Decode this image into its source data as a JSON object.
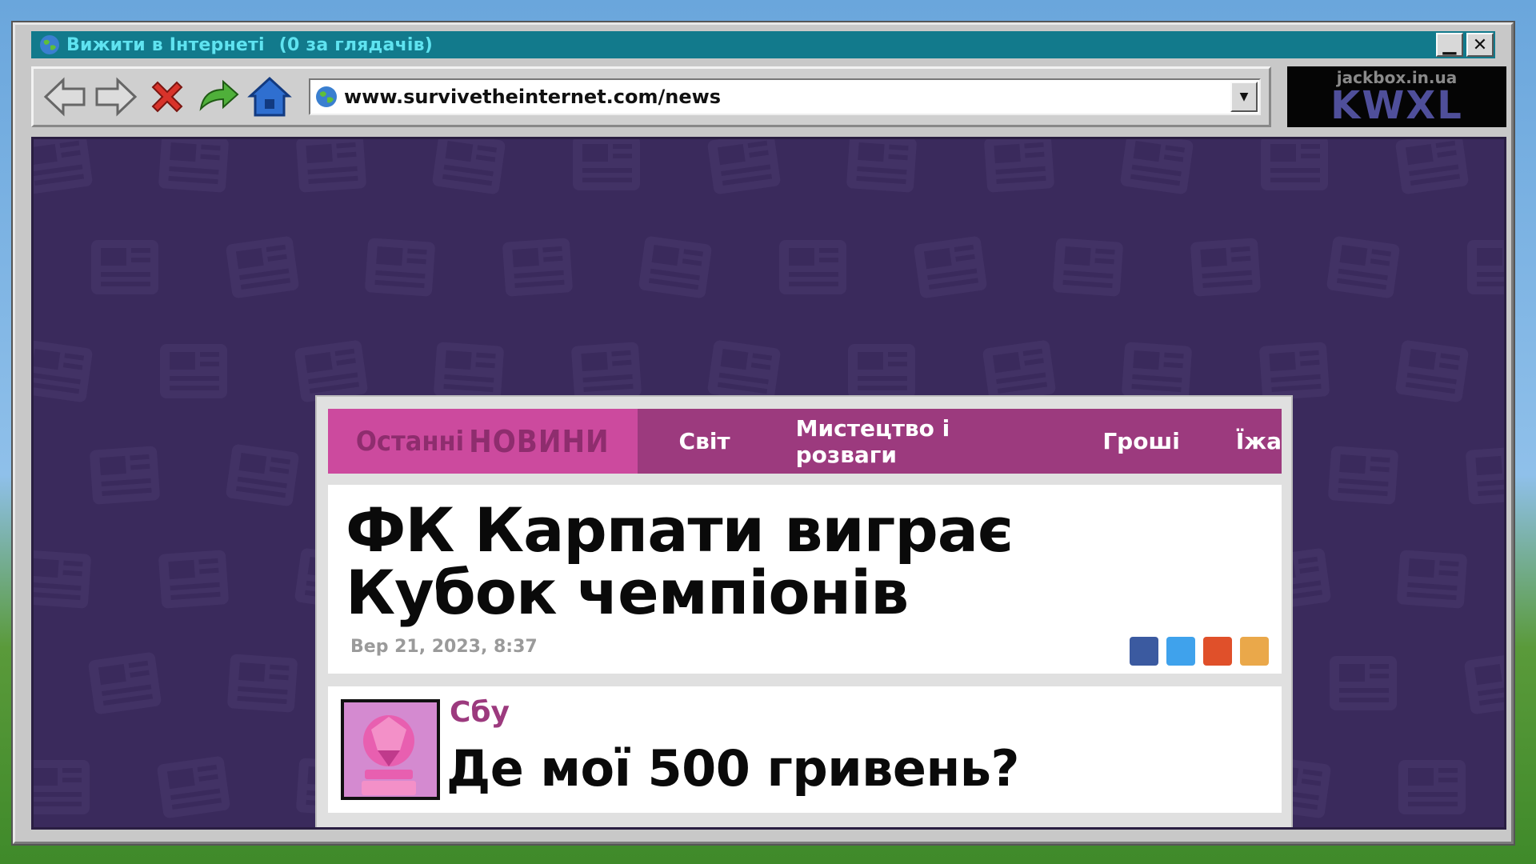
{
  "window": {
    "title": "Вижити в Інтернеті",
    "viewers": "(0 за глядачів)",
    "minimize_label": "▁",
    "close_label": "✕"
  },
  "toolbar": {
    "icons": [
      "back-arrow-icon",
      "forward-arrow-icon",
      "stop-icon",
      "refresh-icon",
      "home-icon"
    ],
    "url": "www.survivetheinternet.com/news",
    "dropdown_label": "▼"
  },
  "room": {
    "domain": "jackbox.in.ua",
    "code": "KWXL"
  },
  "news": {
    "brand_part1": "Останні",
    "brand_part2": "НОВИНИ",
    "nav": [
      "Світ",
      "Мистецтво і розваги",
      "Гроші",
      "Їжа"
    ]
  },
  "article": {
    "headline": "ФК Карпати виграє Кубок чемпіонів",
    "timestamp": "Вер 21, 2023, 8:37",
    "share_colors": [
      "#3b5aa0",
      "#3fa2ec",
      "#e0502a",
      "#eaa84a"
    ]
  },
  "comment": {
    "author": "Сбу",
    "text": "Де мої 500 гривень?"
  },
  "colors": {
    "titlebar": "#127a8c",
    "viewport_bg": "#3a2a5c",
    "nav_bg": "#9c3a7e",
    "brand_bg": "#cc4a9e"
  }
}
